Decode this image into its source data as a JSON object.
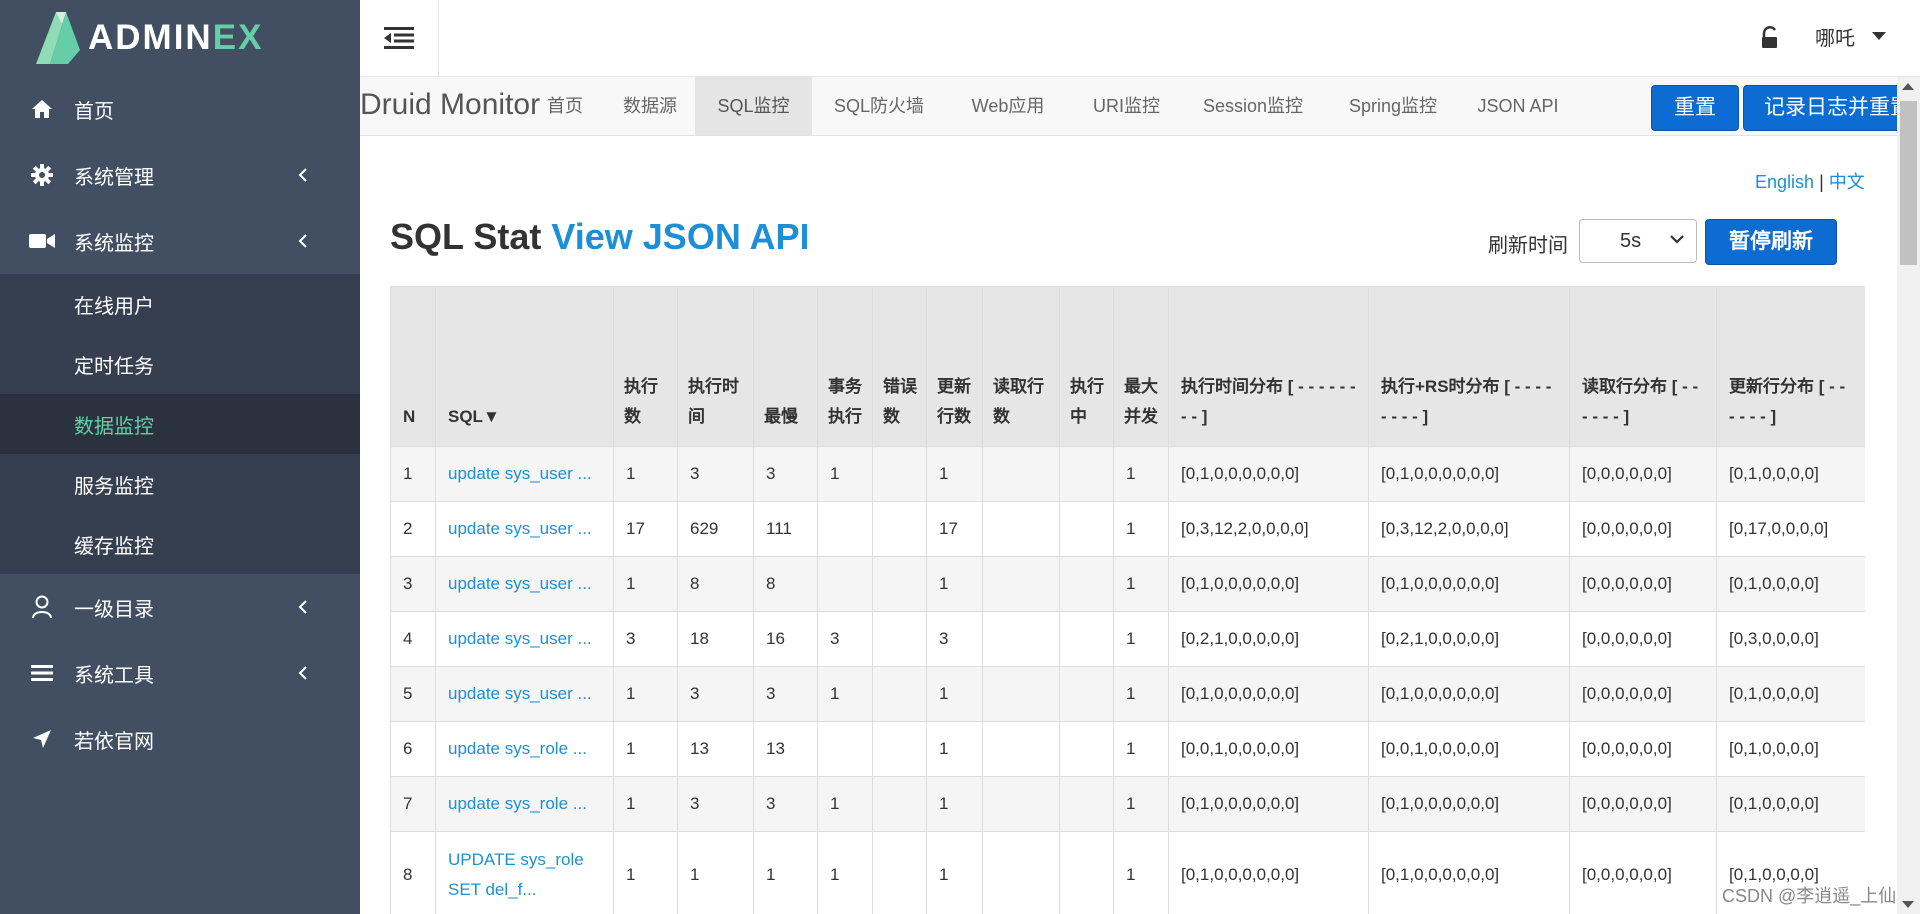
{
  "brand": {
    "logo_text_main": "ADMIN",
    "logo_text_accent": "EX"
  },
  "sidebar": {
    "items": [
      {
        "label": "首页",
        "icon": "home-icon"
      },
      {
        "label": "系统管理",
        "icon": "gear-icon"
      },
      {
        "label": "系统监控",
        "icon": "video-camera-icon"
      },
      {
        "label": "一级目录",
        "icon": "user-icon"
      },
      {
        "label": "系统工具",
        "icon": "bars-icon"
      },
      {
        "label": "若依官网",
        "icon": "location-arrow-icon"
      }
    ],
    "submenu": [
      {
        "label": "在线用户"
      },
      {
        "label": "定时任务"
      },
      {
        "label": "数据监控",
        "active": true
      },
      {
        "label": "服务监控"
      },
      {
        "label": "缓存监控"
      }
    ]
  },
  "header": {
    "user_name": "哪吒"
  },
  "druid": {
    "brand": "Druid Monitor",
    "tabs": [
      "首页",
      "数据源",
      "SQL监控",
      "SQL防火墙",
      "Web应用",
      "URI监控",
      "Session监控",
      "Spring监控",
      "JSON API"
    ],
    "active_tab": "SQL监控",
    "reset_label": "重置",
    "log_reset_label": "记录日志并重置"
  },
  "lang": {
    "english": "English",
    "sep": "|",
    "chinese": "中文"
  },
  "title": {
    "main": "SQL Stat",
    "link": "View JSON API"
  },
  "refresh": {
    "label": "刷新时间",
    "value": "5s",
    "pause_label": "暂停刷新"
  },
  "table": {
    "headers": [
      "N",
      "SQL▼",
      "执行数",
      "执行时间",
      "最慢",
      "事务执行",
      "错误数",
      "更新行数",
      "读取行数",
      "执行中",
      "最大并发",
      "执行时间分布 [ - - - - - - - - ]",
      "执行+RS时分布 [ - - - - - - - - ]",
      "读取行分布 [ - - - - - - ]",
      "更新行分布 [ - - - - - - ]"
    ],
    "rows": [
      [
        "1",
        "update sys_user ...",
        "1",
        "3",
        "3",
        "1",
        "",
        "1",
        "",
        "",
        "1",
        "[0,1,0,0,0,0,0,0]",
        "[0,1,0,0,0,0,0,0]",
        "[0,0,0,0,0,0]",
        "[0,1,0,0,0,0]"
      ],
      [
        "2",
        "update sys_user ...",
        "17",
        "629",
        "111",
        "",
        "",
        "17",
        "",
        "",
        "1",
        "[0,3,12,2,0,0,0,0]",
        "[0,3,12,2,0,0,0,0]",
        "[0,0,0,0,0,0]",
        "[0,17,0,0,0,0]"
      ],
      [
        "3",
        "update sys_user ...",
        "1",
        "8",
        "8",
        "",
        "",
        "1",
        "",
        "",
        "1",
        "[0,1,0,0,0,0,0,0]",
        "[0,1,0,0,0,0,0,0]",
        "[0,0,0,0,0,0]",
        "[0,1,0,0,0,0]"
      ],
      [
        "4",
        "update sys_user ...",
        "3",
        "18",
        "16",
        "3",
        "",
        "3",
        "",
        "",
        "1",
        "[0,2,1,0,0,0,0,0]",
        "[0,2,1,0,0,0,0,0]",
        "[0,0,0,0,0,0]",
        "[0,3,0,0,0,0]"
      ],
      [
        "5",
        "update sys_user ...",
        "1",
        "3",
        "3",
        "1",
        "",
        "1",
        "",
        "",
        "1",
        "[0,1,0,0,0,0,0,0]",
        "[0,1,0,0,0,0,0,0]",
        "[0,0,0,0,0,0]",
        "[0,1,0,0,0,0]"
      ],
      [
        "6",
        "update sys_role ...",
        "1",
        "13",
        "13",
        "",
        "",
        "1",
        "",
        "",
        "1",
        "[0,0,1,0,0,0,0,0]",
        "[0,0,1,0,0,0,0,0]",
        "[0,0,0,0,0,0]",
        "[0,1,0,0,0,0]"
      ],
      [
        "7",
        "update sys_role ...",
        "1",
        "3",
        "3",
        "1",
        "",
        "1",
        "",
        "",
        "1",
        "[0,1,0,0,0,0,0,0]",
        "[0,1,0,0,0,0,0,0]",
        "[0,0,0,0,0,0]",
        "[0,1,0,0,0,0]"
      ],
      [
        "8",
        "UPDATE sys_role SET del_f...",
        "1",
        "1",
        "1",
        "1",
        "",
        "1",
        "",
        "",
        "1",
        "[0,1,0,0,0,0,0,0]",
        "[0,1,0,0,0,0,0,0]",
        "[0,0,0,0,0,0]",
        "[0,1,0,0,0,0]"
      ]
    ]
  },
  "watermark": "CSDN @李逍遥_上仙"
}
